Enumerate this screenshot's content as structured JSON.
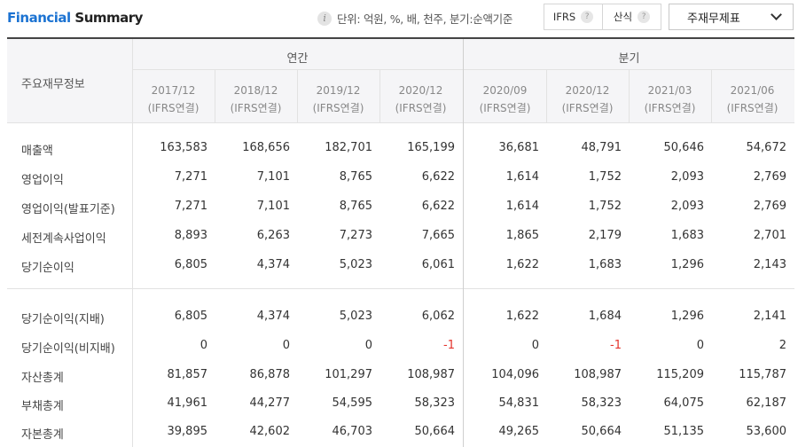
{
  "header": {
    "title_blue": "Financial",
    "title_dark": " Summary",
    "unit_text": "단위: 억원, %, 배, 천주, 분기:순액기준",
    "toggle": [
      {
        "label": "IFRS"
      },
      {
        "label": "산식"
      }
    ],
    "dropdown_label": "주재무제표"
  },
  "table": {
    "corner_label": "주요재무정보",
    "groups": [
      "연간",
      "분기"
    ],
    "periods": [
      {
        "date": "2017/12",
        "basis": "(IFRS연결)"
      },
      {
        "date": "2018/12",
        "basis": "(IFRS연결)"
      },
      {
        "date": "2019/12",
        "basis": "(IFRS연결)"
      },
      {
        "date": "2020/12",
        "basis": "(IFRS연결)"
      },
      {
        "date": "2020/09",
        "basis": "(IFRS연결)"
      },
      {
        "date": "2020/12",
        "basis": "(IFRS연결)"
      },
      {
        "date": "2021/03",
        "basis": "(IFRS연결)"
      },
      {
        "date": "2021/06",
        "basis": "(IFRS연결)"
      }
    ],
    "rows": [
      {
        "label": "매출액",
        "values": [
          "163,583",
          "168,656",
          "182,701",
          "165,199",
          "36,681",
          "48,791",
          "50,646",
          "54,672"
        ]
      },
      {
        "label": "영업이익",
        "values": [
          "7,271",
          "7,101",
          "8,765",
          "6,622",
          "1,614",
          "1,752",
          "2,093",
          "2,769"
        ]
      },
      {
        "label": "영업이익(발표기준)",
        "values": [
          "7,271",
          "7,101",
          "8,765",
          "6,622",
          "1,614",
          "1,752",
          "2,093",
          "2,769"
        ]
      },
      {
        "label": "세전계속사업이익",
        "values": [
          "8,893",
          "6,263",
          "7,273",
          "7,665",
          "1,865",
          "2,179",
          "1,683",
          "2,701"
        ]
      },
      {
        "label": "당기순이익",
        "values": [
          "6,805",
          "4,374",
          "5,023",
          "6,061",
          "1,622",
          "1,683",
          "1,296",
          "2,143"
        ]
      },
      {
        "label": "당기순이익(지배)",
        "values": [
          "6,805",
          "4,374",
          "5,023",
          "6,062",
          "1,622",
          "1,684",
          "1,296",
          "2,141"
        ]
      },
      {
        "label": "당기순이익(비지배)",
        "values": [
          "0",
          "0",
          "0",
          "-1",
          "0",
          "-1",
          "0",
          "2"
        ]
      },
      {
        "label": "자산총계",
        "values": [
          "81,857",
          "86,878",
          "101,297",
          "108,987",
          "104,096",
          "108,987",
          "115,209",
          "115,787"
        ]
      },
      {
        "label": "부채총계",
        "values": [
          "41,961",
          "44,277",
          "54,595",
          "58,323",
          "54,831",
          "58,323",
          "64,075",
          "62,187"
        ]
      },
      {
        "label": "자본총계",
        "values": [
          "39,895",
          "42,602",
          "46,703",
          "50,664",
          "49,265",
          "50,664",
          "51,135",
          "53,600"
        ]
      }
    ]
  }
}
